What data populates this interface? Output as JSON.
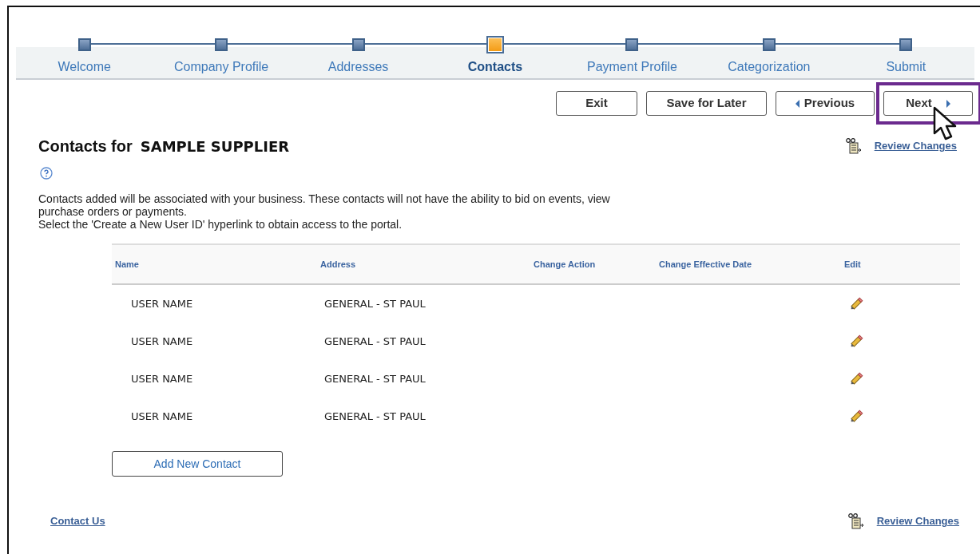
{
  "steps": [
    {
      "label": "Welcome",
      "selected": false
    },
    {
      "label": "Company Profile",
      "selected": false
    },
    {
      "label": "Addresses",
      "selected": false
    },
    {
      "label": "Contacts",
      "selected": true
    },
    {
      "label": "Payment Profile",
      "selected": false
    },
    {
      "label": "Categorization",
      "selected": false
    },
    {
      "label": "Submit",
      "selected": false
    }
  ],
  "buttons": [
    {
      "label": "Exit",
      "kind": "plain",
      "highlighted": false
    },
    {
      "label": "Save for Later",
      "kind": "plain",
      "highlighted": false
    },
    {
      "label": "Previous",
      "kind": "previous",
      "highlighted": false
    },
    {
      "label": "Next",
      "kind": "next",
      "highlighted": true
    }
  ],
  "heading": {
    "prefix": "Contacts for",
    "supplier": "SAMPLE SUPPLIER"
  },
  "review_link_top": "Review Changes",
  "description": [
    "Contacts added will be associated with your business. These contacts will not have the ability to bid on events, view purchase orders or payments.",
    "Select the 'Create a New User ID' hyperlink to obtain access to the portal."
  ],
  "table": {
    "columns": [
      "Name",
      "Address",
      "Change Action",
      "Change Effective Date",
      "Edit"
    ],
    "rows": [
      {
        "name": "USER NAME",
        "address": "GENERAL - ST PAUL"
      },
      {
        "name": "USER NAME",
        "address": "GENERAL - ST PAUL"
      },
      {
        "name": "USER NAME",
        "address": "GENERAL - ST PAUL"
      },
      {
        "name": "USER NAME",
        "address": "GENERAL - ST PAUL"
      }
    ]
  },
  "add_button": "Add New Contact",
  "footer": {
    "contact_link": "Contact Us",
    "review_link": "Review Changes"
  }
}
